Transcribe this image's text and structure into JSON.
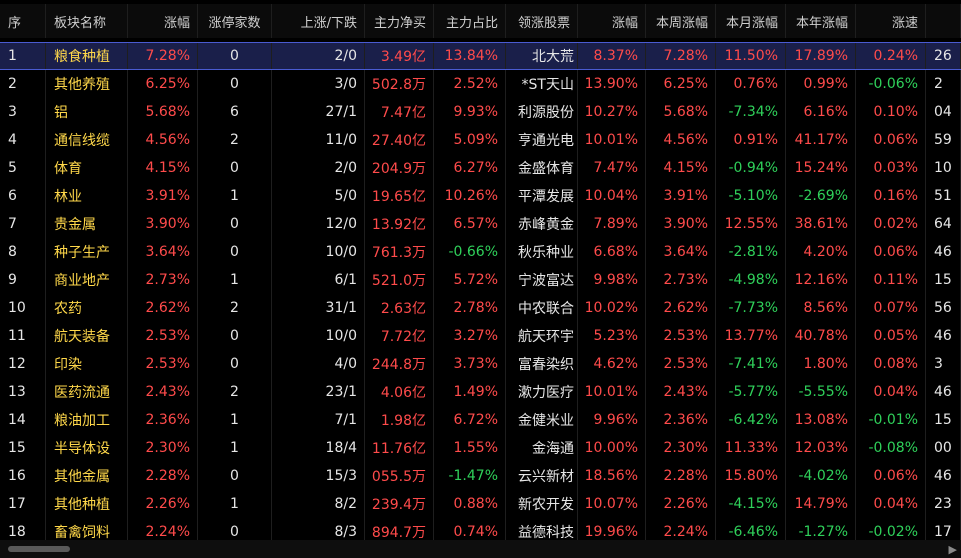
{
  "columns": [
    {
      "key": "seq",
      "label": "序"
    },
    {
      "key": "name",
      "label": "板块名称"
    },
    {
      "key": "chg",
      "label": "涨幅",
      "sorted": true
    },
    {
      "key": "limit",
      "label": "涨停家数"
    },
    {
      "key": "updown",
      "label": "上涨/下跌"
    },
    {
      "key": "net",
      "label": "主力净买"
    },
    {
      "key": "ratio",
      "label": "主力占比"
    },
    {
      "key": "lead",
      "label": "领涨股票"
    },
    {
      "key": "lchg",
      "label": "涨幅"
    },
    {
      "key": "week",
      "label": "本周涨幅"
    },
    {
      "key": "month",
      "label": "本月涨幅"
    },
    {
      "key": "year",
      "label": "本年涨幅"
    },
    {
      "key": "speed",
      "label": "涨速"
    },
    {
      "key": "extra",
      "label": ""
    }
  ],
  "rows": [
    {
      "seq": "1",
      "name": "粮食种植",
      "chg": "7.28%",
      "limit": "0",
      "updown": "2/0",
      "net": "3.49亿",
      "ratio": "13.84%",
      "lead": "北大荒",
      "lchg": "8.37%",
      "week": "7.28%",
      "month": "11.50%",
      "year": "17.89%",
      "speed": "0.24%",
      "extra": "26",
      "selected": true
    },
    {
      "seq": "2",
      "name": "其他养殖",
      "chg": "6.25%",
      "limit": "0",
      "updown": "3/0",
      "net": "502.8万",
      "ratio": "2.52%",
      "lead": "*ST天山",
      "lchg": "13.90%",
      "week": "6.25%",
      "month": "0.76%",
      "year": "0.99%",
      "speed": "-0.06%",
      "extra": "2"
    },
    {
      "seq": "3",
      "name": "铝",
      "chg": "5.68%",
      "limit": "6",
      "updown": "27/1",
      "net": "7.47亿",
      "ratio": "9.93%",
      "lead": "利源股份",
      "lchg": "10.27%",
      "week": "5.68%",
      "month": "-7.34%",
      "year": "6.16%",
      "speed": "0.10%",
      "extra": "04"
    },
    {
      "seq": "4",
      "name": "通信线缆",
      "chg": "4.56%",
      "limit": "2",
      "updown": "11/0",
      "net": "27.40亿",
      "ratio": "5.09%",
      "lead": "亨通光电",
      "lchg": "10.01%",
      "week": "4.56%",
      "month": "0.91%",
      "year": "41.17%",
      "speed": "0.06%",
      "extra": "59"
    },
    {
      "seq": "5",
      "name": "体育",
      "chg": "4.15%",
      "limit": "0",
      "updown": "2/0",
      "net": "204.9万",
      "ratio": "6.27%",
      "lead": "金盛体育",
      "lchg": "7.47%",
      "week": "4.15%",
      "month": "-0.94%",
      "year": "15.24%",
      "speed": "0.03%",
      "extra": "10"
    },
    {
      "seq": "6",
      "name": "林业",
      "chg": "3.91%",
      "limit": "1",
      "updown": "5/0",
      "net": "19.65亿",
      "ratio": "10.26%",
      "lead": "平潭发展",
      "lchg": "10.04%",
      "week": "3.91%",
      "month": "-5.10%",
      "year": "-2.69%",
      "speed": "0.16%",
      "extra": "51"
    },
    {
      "seq": "7",
      "name": "贵金属",
      "chg": "3.90%",
      "limit": "0",
      "updown": "12/0",
      "net": "13.92亿",
      "ratio": "6.57%",
      "lead": "赤峰黄金",
      "lchg": "7.89%",
      "week": "3.90%",
      "month": "12.55%",
      "year": "38.61%",
      "speed": "0.02%",
      "extra": "64"
    },
    {
      "seq": "8",
      "name": "种子生产",
      "chg": "3.64%",
      "limit": "0",
      "updown": "10/0",
      "net": "761.3万",
      "ratio": "-0.66%",
      "lead": "秋乐种业",
      "lchg": "6.68%",
      "week": "3.64%",
      "month": "-2.81%",
      "year": "4.20%",
      "speed": "0.06%",
      "extra": "46"
    },
    {
      "seq": "9",
      "name": "商业地产",
      "chg": "2.73%",
      "limit": "1",
      "updown": "6/1",
      "net": "521.0万",
      "ratio": "5.72%",
      "lead": "宁波富达",
      "lchg": "9.98%",
      "week": "2.73%",
      "month": "-4.98%",
      "year": "12.16%",
      "speed": "0.11%",
      "extra": "15"
    },
    {
      "seq": "10",
      "name": "农药",
      "chg": "2.62%",
      "limit": "2",
      "updown": "31/1",
      "net": "2.63亿",
      "ratio": "2.78%",
      "lead": "中农联合",
      "lchg": "10.02%",
      "week": "2.62%",
      "month": "-7.73%",
      "year": "8.56%",
      "speed": "0.07%",
      "extra": "56"
    },
    {
      "seq": "11",
      "name": "航天装备",
      "chg": "2.53%",
      "limit": "0",
      "updown": "10/0",
      "net": "7.72亿",
      "ratio": "3.27%",
      "lead": "航天环宇",
      "lchg": "5.23%",
      "week": "2.53%",
      "month": "13.77%",
      "year": "40.78%",
      "speed": "0.05%",
      "extra": "46"
    },
    {
      "seq": "12",
      "name": "印染",
      "chg": "2.53%",
      "limit": "0",
      "updown": "4/0",
      "net": "244.8万",
      "ratio": "3.73%",
      "lead": "富春染织",
      "lchg": "4.62%",
      "week": "2.53%",
      "month": "-7.41%",
      "year": "1.80%",
      "speed": "0.08%",
      "extra": "3"
    },
    {
      "seq": "13",
      "name": "医药流通",
      "chg": "2.43%",
      "limit": "2",
      "updown": "23/1",
      "net": "4.06亿",
      "ratio": "1.49%",
      "lead": "漱力医疗",
      "lchg": "10.01%",
      "week": "2.43%",
      "month": "-5.77%",
      "year": "-5.55%",
      "speed": "0.04%",
      "extra": "46"
    },
    {
      "seq": "14",
      "name": "粮油加工",
      "chg": "2.36%",
      "limit": "1",
      "updown": "7/1",
      "net": "1.98亿",
      "ratio": "6.72%",
      "lead": "金健米业",
      "lchg": "9.96%",
      "week": "2.36%",
      "month": "-6.42%",
      "year": "13.08%",
      "speed": "-0.01%",
      "extra": "15"
    },
    {
      "seq": "15",
      "name": "半导体设",
      "chg": "2.30%",
      "limit": "1",
      "updown": "18/4",
      "net": "11.76亿",
      "ratio": "1.55%",
      "lead": "金海通",
      "lchg": "10.00%",
      "week": "2.30%",
      "month": "11.33%",
      "year": "12.03%",
      "speed": "-0.08%",
      "extra": "00"
    },
    {
      "seq": "16",
      "name": "其他金属",
      "chg": "2.28%",
      "limit": "0",
      "updown": "15/3",
      "net": "055.5万",
      "ratio": "-1.47%",
      "lead": "云兴新材",
      "lchg": "18.56%",
      "week": "2.28%",
      "month": "15.80%",
      "year": "-4.02%",
      "speed": "0.06%",
      "extra": "46"
    },
    {
      "seq": "17",
      "name": "其他种植",
      "chg": "2.26%",
      "limit": "1",
      "updown": "8/2",
      "net": "239.4万",
      "ratio": "0.88%",
      "lead": "新农开发",
      "lchg": "10.07%",
      "week": "2.26%",
      "month": "-4.15%",
      "year": "14.79%",
      "speed": "0.04%",
      "extra": "23"
    },
    {
      "seq": "18",
      "name": "畜禽饲料",
      "chg": "2.24%",
      "limit": "0",
      "updown": "8/3",
      "net": "894.7万",
      "ratio": "0.74%",
      "lead": "益德科技",
      "lchg": "19.96%",
      "week": "2.24%",
      "month": "-6.46%",
      "year": "-1.27%",
      "speed": "-0.02%",
      "extra": "17"
    }
  ],
  "colors": {
    "up": "#ff4b4b",
    "down": "#2fd05a",
    "name": "#ffd84a",
    "neutral": "#e6e6e6",
    "selected_bg": "#1a1f4a"
  }
}
